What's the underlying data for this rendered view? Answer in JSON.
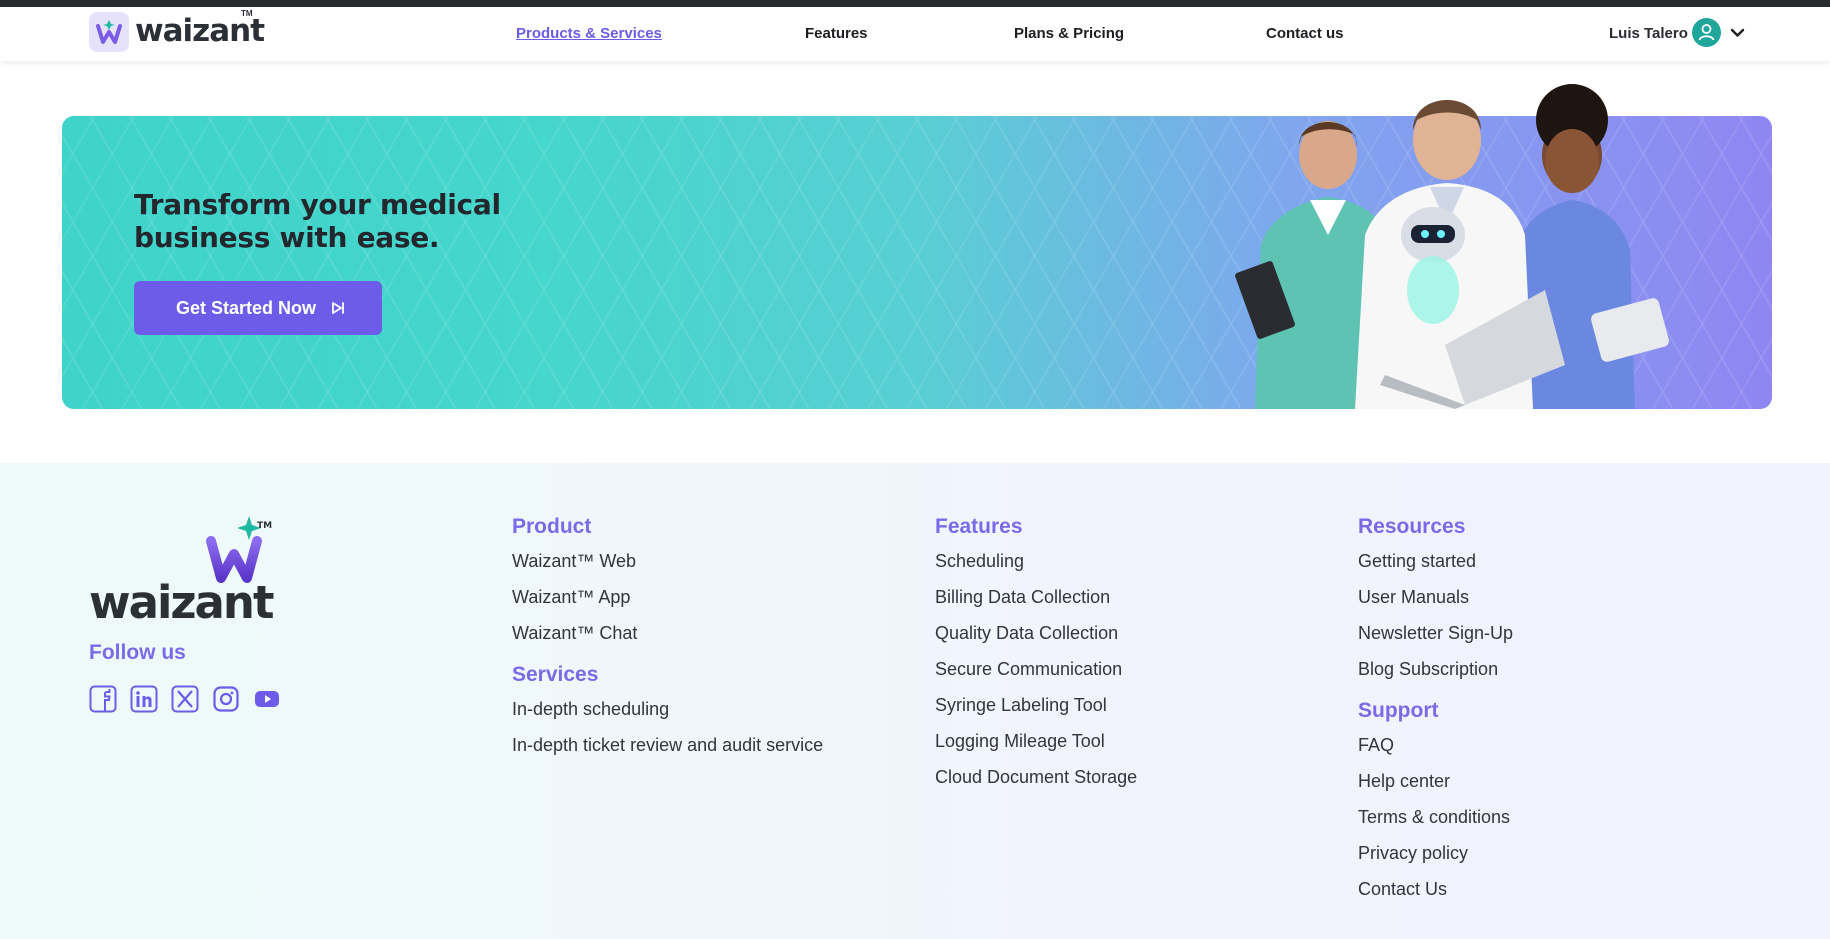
{
  "brand": {
    "name": "waizant",
    "tm": "TM"
  },
  "nav": {
    "items": [
      "Products & Services",
      "Features",
      "Plans & Pricing",
      "Contact us"
    ],
    "active": "Products & Services"
  },
  "user": {
    "name": "Luis Talero"
  },
  "banner": {
    "title": "Transform your medical business with ease.",
    "cta": "Get Started Now"
  },
  "footer": {
    "follow_label": "Follow us",
    "socials": [
      "facebook-icon",
      "linkedin-icon",
      "x-icon",
      "instagram-icon",
      "youtube-icon"
    ],
    "product": {
      "title": "Product",
      "items": [
        "Waizant™ Web",
        "Waizant™ App",
        "Waizant™ Chat"
      ]
    },
    "services": {
      "title": "Services",
      "items": [
        "In-depth scheduling",
        "In-depth ticket review and audit service"
      ]
    },
    "features": {
      "title": "Features",
      "items": [
        "Scheduling",
        "Billing Data Collection",
        "Quality Data Collection",
        "Secure Communication",
        "Syringe Labeling Tool",
        "Logging Mileage Tool",
        "Cloud Document Storage"
      ]
    },
    "resources": {
      "title": "Resources",
      "items": [
        "Getting started",
        "User Manuals",
        "Newsletter Sign-Up",
        "Blog Subscription"
      ]
    },
    "support": {
      "title": "Support",
      "items": [
        "FAQ",
        "Help center",
        "Terms & conditions",
        "Privacy policy",
        "Contact Us"
      ]
    }
  },
  "colors": {
    "accent": "#6c5ce7",
    "teal": "#3fd3c9",
    "heading": "#7a6ae8"
  }
}
